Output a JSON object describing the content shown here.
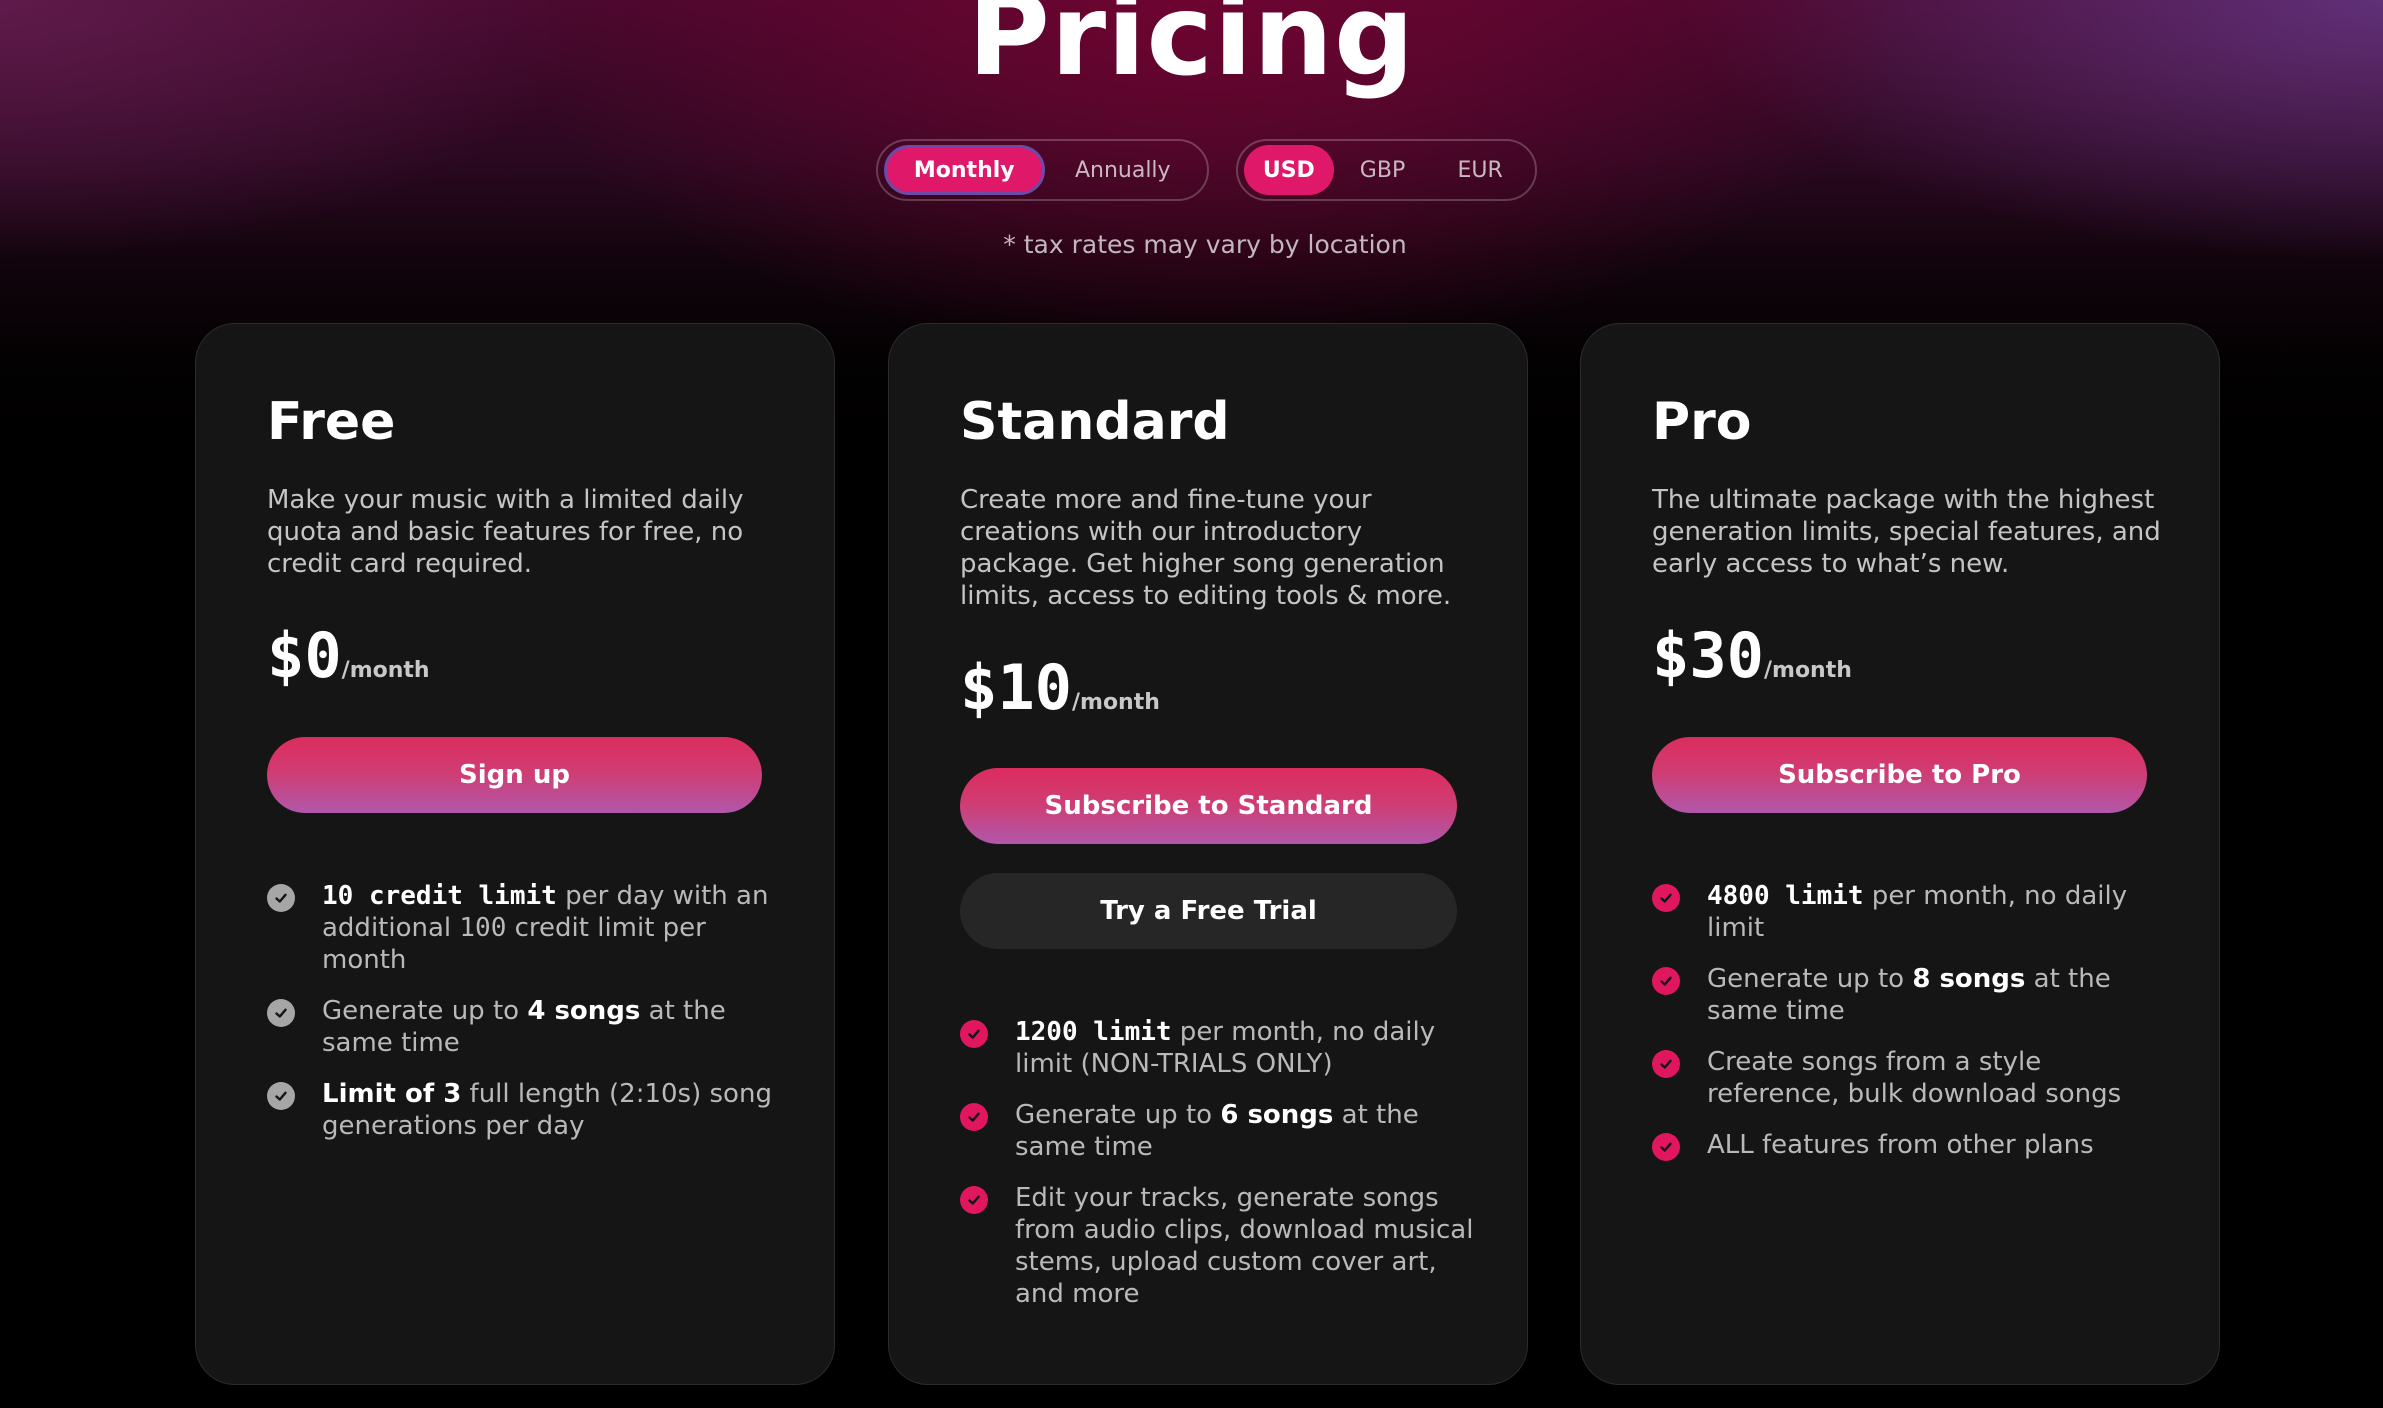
{
  "page": {
    "title": "Pricing",
    "tax_note": "* tax rates may vary by location"
  },
  "billing_toggle": {
    "monthly": "Monthly",
    "annually": "Annually",
    "selected": "Monthly"
  },
  "currency_toggle": {
    "usd": "USD",
    "gbp": "GBP",
    "eur": "EUR",
    "selected": "USD"
  },
  "colors": {
    "accent": "#e0186a",
    "card_bg": "#151515",
    "free_check": "#a6a6a6",
    "paid_check": "#e0165f"
  },
  "plans": [
    {
      "name": "Free",
      "description": "Make your music with a limited daily quota and basic features for free, no credit card required.",
      "price": "$0",
      "period": "/month",
      "cta": "Sign up",
      "features": [
        {
          "bold": "10 credit limit",
          "text": " per day with an additional ",
          "mono": "100",
          "text2": " credit limit per month"
        },
        {
          "text": "Generate up to ",
          "bold": "4 songs",
          "text2": " at the same time"
        },
        {
          "bold": "Limit of 3",
          "text": " full length (2:10s) song generations per day"
        }
      ]
    },
    {
      "name": "Standard",
      "description": "Create more and fine-tune your creations with our introductory package. Get higher song generation limits, access to editing tools & more.",
      "price": "$10",
      "period": "/month",
      "cta": "Subscribe to Standard",
      "secondary_cta": "Try a Free Trial",
      "features": [
        {
          "bold": "1200 limit",
          "text": " per month, no daily limit (NON-TRIALS ONLY)"
        },
        {
          "text": "Generate up to ",
          "bold": "6 songs",
          "text2": " at the same time"
        },
        {
          "text": "Edit your tracks, generate songs from audio clips, download musical stems, upload custom cover art, and more"
        }
      ]
    },
    {
      "name": "Pro",
      "description": "The ultimate package with the highest generation limits, special features, and early access to what’s new.",
      "price": "$30",
      "period": "/month",
      "cta": "Subscribe to Pro",
      "features": [
        {
          "bold": "4800 limit",
          "text": " per month, no daily limit"
        },
        {
          "text": "Generate up to ",
          "bold": "8 songs",
          "text2": " at the same time"
        },
        {
          "text": "Create songs from a style reference, bulk download songs"
        },
        {
          "text": "ALL features from other plans"
        }
      ]
    }
  ]
}
